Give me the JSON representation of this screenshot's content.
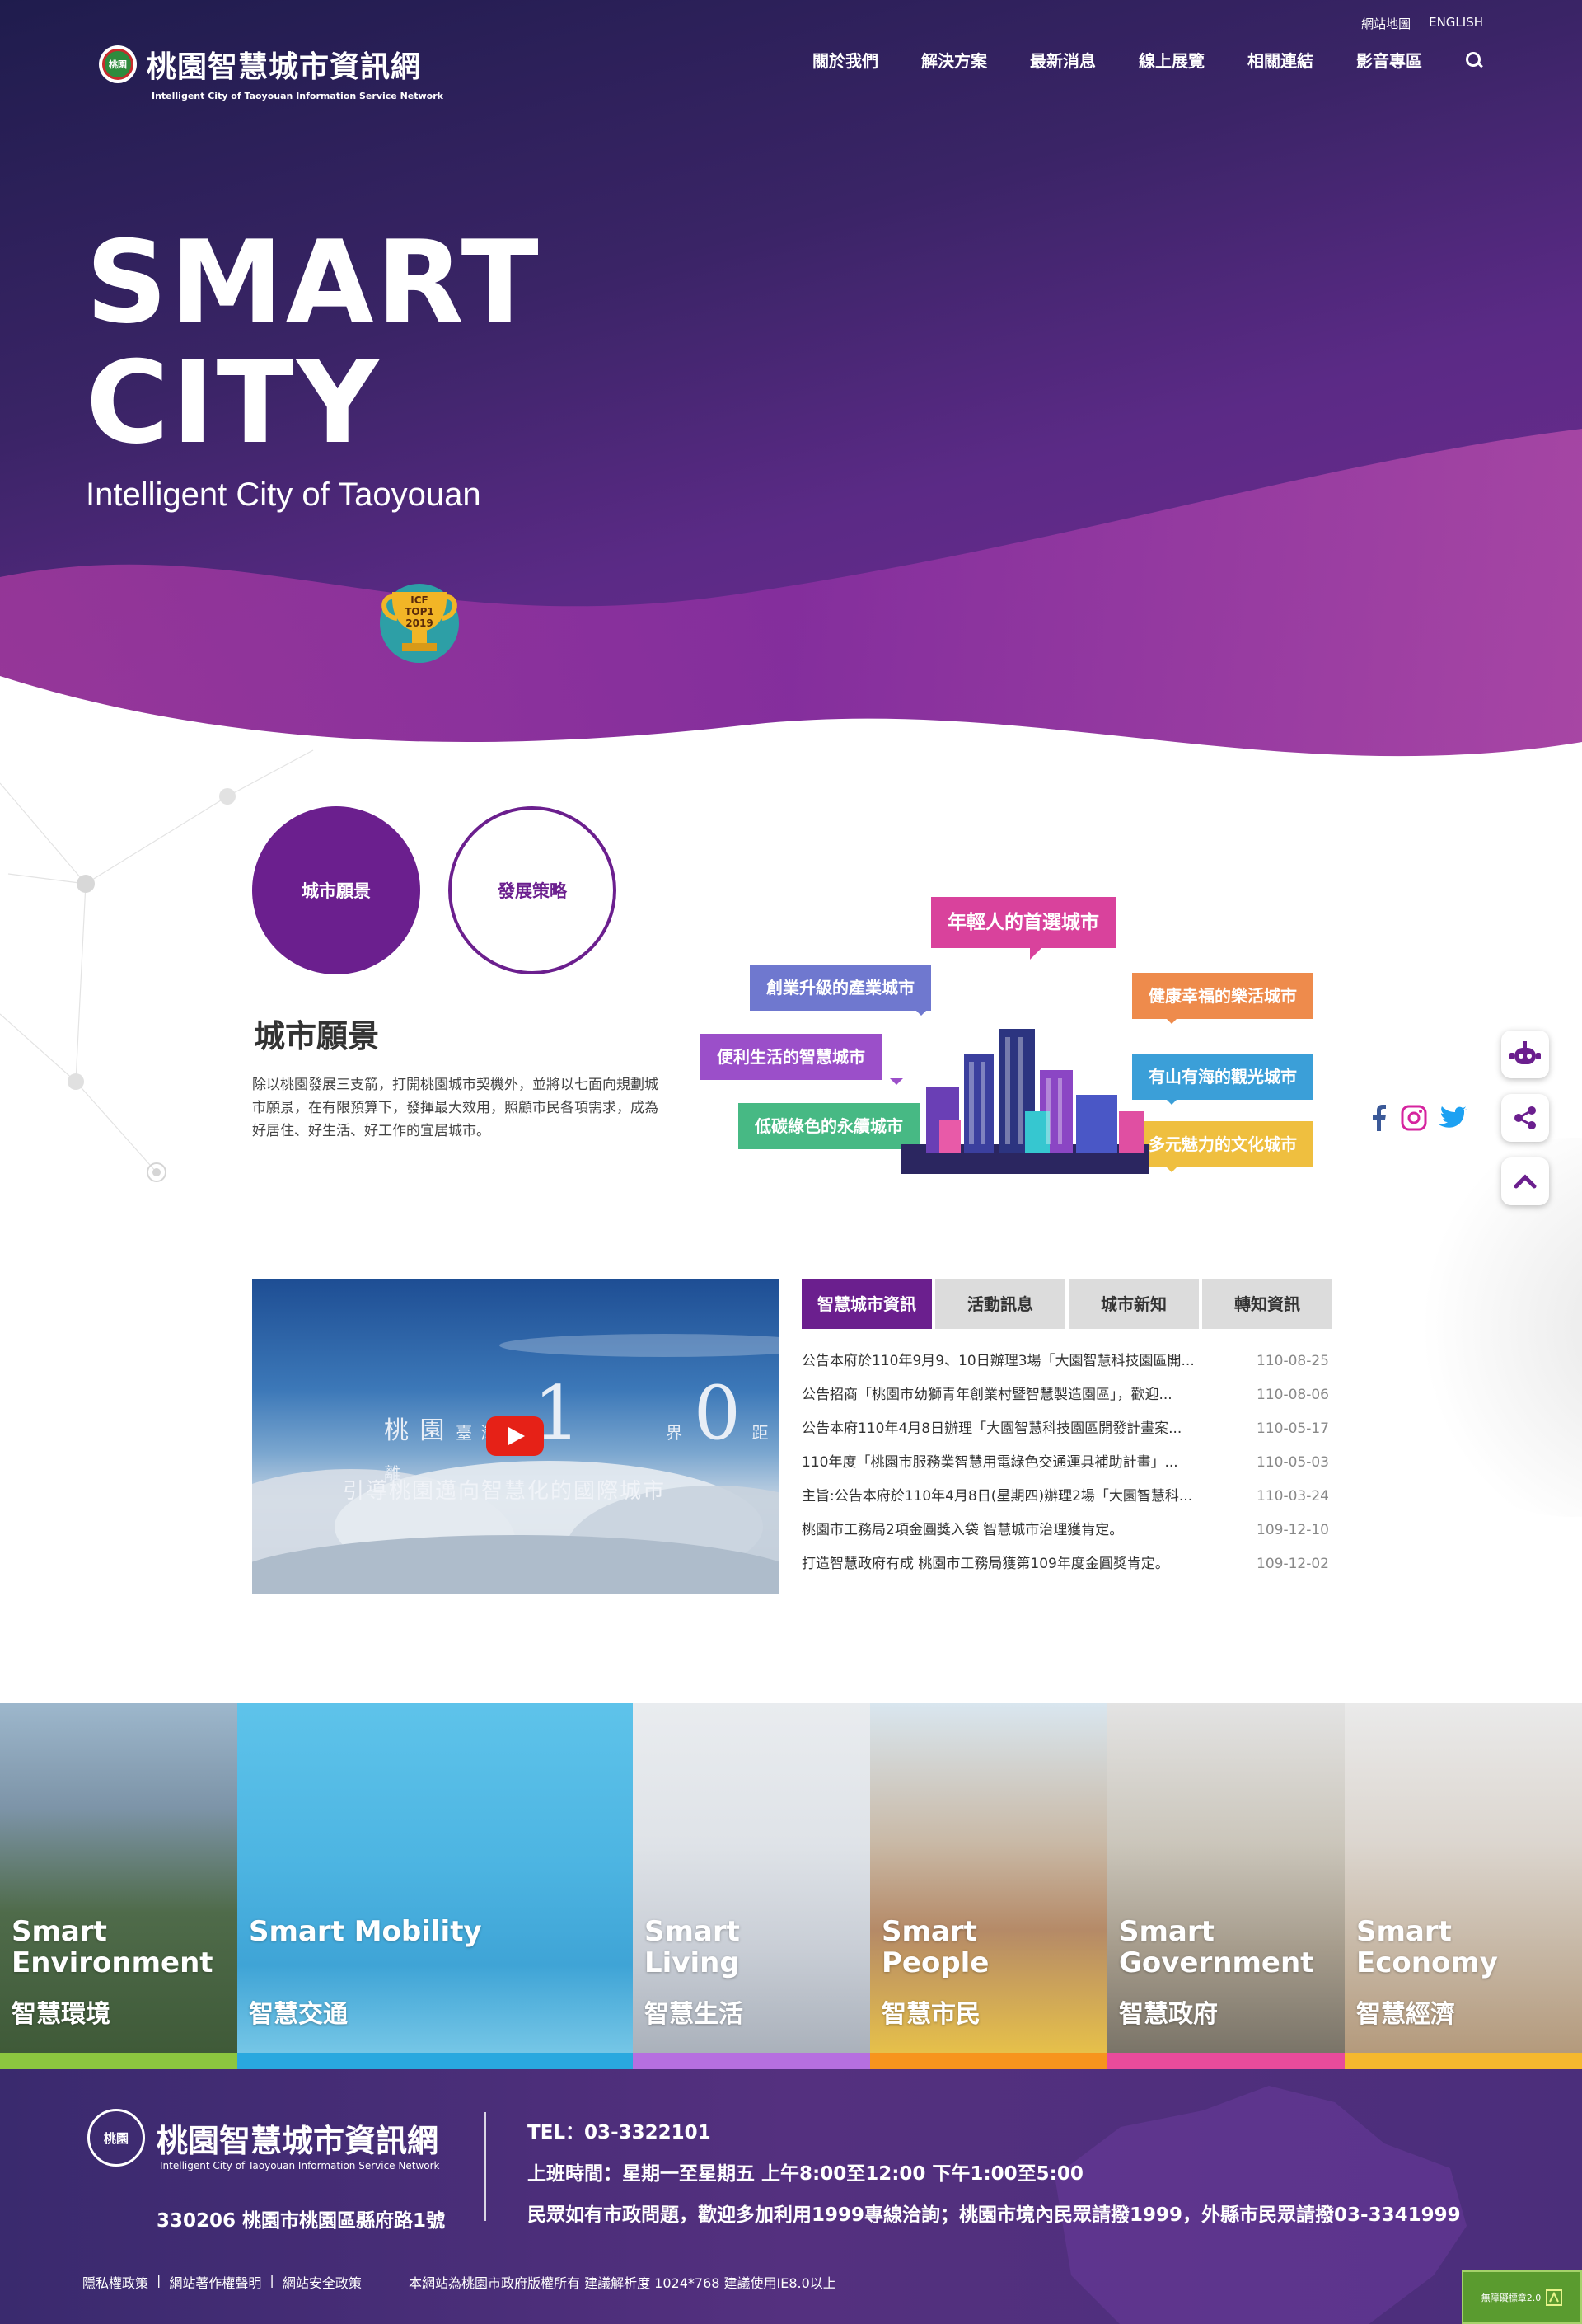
{
  "topbar": {
    "sitemap": "網站地圖",
    "english": "ENGLISH"
  },
  "logo": {
    "emblem_text": "桃園",
    "title": "桃園智慧城市資訊網",
    "subtitle": "Intelligent City of Taoyouan Information Service Network"
  },
  "nav": {
    "items": [
      "關於我們",
      "解決方案",
      "最新消息",
      "線上展覽",
      "相關連結",
      "影音專區"
    ]
  },
  "hero": {
    "title_line1": "SMART",
    "title_line2": "CITY",
    "subtitle": "Intelligent City of Taoyouan",
    "trophy_text1": "ICF",
    "trophy_text2": "TOP1",
    "trophy_text3": "2019"
  },
  "vision": {
    "btn_vision": "城市願景",
    "btn_strategy": "發展策略",
    "heading": "城市願景",
    "text": "除以桃園發展三支箭，打開桃園城市契機外，並將以七面向規劃城市願景，在有限預算下，發揮最大效用，照顧市民各項需求，成為好居住、好生活、好工作的宜居城市。",
    "bubbles": {
      "young": "年輕人的首選城市",
      "industry": "創業升級的產業城市",
      "convenient": "便利生活的智慧城市",
      "green": "低碳綠色的永續城市",
      "health": "健康幸福的樂活城市",
      "sea": "有山有海的觀光城市",
      "culture": "多元魅力的文化城市"
    }
  },
  "video": {
    "line1_a": "桃 園",
    "line1_b": "臺 灣 第",
    "num1": "1",
    "line1_c": "界",
    "num0": "0",
    "line1_d": "距 離",
    "line2": "引導桃園邁向智慧化的國際城市"
  },
  "tabs": [
    "智慧城市資訊",
    "活動訊息",
    "城市新知",
    "轉知資訊"
  ],
  "news": [
    {
      "title": "公告本府於110年9月9、10日辦理3場「大園智慧科技園區開...",
      "date": "110-08-25"
    },
    {
      "title": "公告招商「桃園市幼獅青年創業村暨智慧製造園區」，歡迎...",
      "date": "110-08-06"
    },
    {
      "title": "公告本府110年4月8日辦理「大園智慧科技園區開發計畫案...",
      "date": "110-05-17"
    },
    {
      "title": "110年度「桃園市服務業智慧用電綠色交通運具補助計畫」...",
      "date": "110-05-03"
    },
    {
      "title": "主旨:公告本府於110年4月8日(星期四)辦理2場「大園智慧科...",
      "date": "110-03-24"
    },
    {
      "title": "桃園市工務局2項金圓獎入袋 智慧城市治理獲肯定。",
      "date": "109-12-10"
    },
    {
      "title": "打造智慧政府有成 桃園市工務局獲第109年度金圓獎肯定。",
      "date": "109-12-02"
    }
  ],
  "strips": [
    {
      "en1": "Smart",
      "en2": "Environment",
      "zh": "智慧環境",
      "bar": "#8cc63f"
    },
    {
      "en1": "",
      "en2": "Smart Mobility",
      "zh": "智慧交通",
      "bar": "#29a8df"
    },
    {
      "en1": "Smart",
      "en2": "Living",
      "zh": "智慧生活",
      "bar": "#b66fe0"
    },
    {
      "en1": "Smart",
      "en2": "People",
      "zh": "智慧市民",
      "bar": "#f7941d"
    },
    {
      "en1": "Smart",
      "en2": "Government",
      "zh": "智慧政府",
      "bar": "#e94b9b"
    },
    {
      "en1": "Smart",
      "en2": "Economy",
      "zh": "智慧經濟",
      "bar": "#f5b82e"
    }
  ],
  "footer": {
    "title": "桃園智慧城市資訊網",
    "subtitle": "Intelligent City of Taoyouan Information Service Network",
    "address": "330206 桃園市桃園區縣府路1號",
    "tel": "TEL：03-3322101",
    "hours": "上班時間：星期一至星期五 上午8:00至12:00 下午1:00至5:00",
    "hotline": "民眾如有市政問題，歡迎多加利用1999專線洽詢；桃園市境內民眾請撥1999，外縣市民眾請撥03-3341999",
    "links": [
      "隱私權政策",
      "網站著作權聲明",
      "網站安全政策"
    ],
    "copyright": "本網站為桃園市政府版權所有 建議解析度 1024*768 建議使用IE8.0以上",
    "badge": "無障礙標章2.0"
  }
}
